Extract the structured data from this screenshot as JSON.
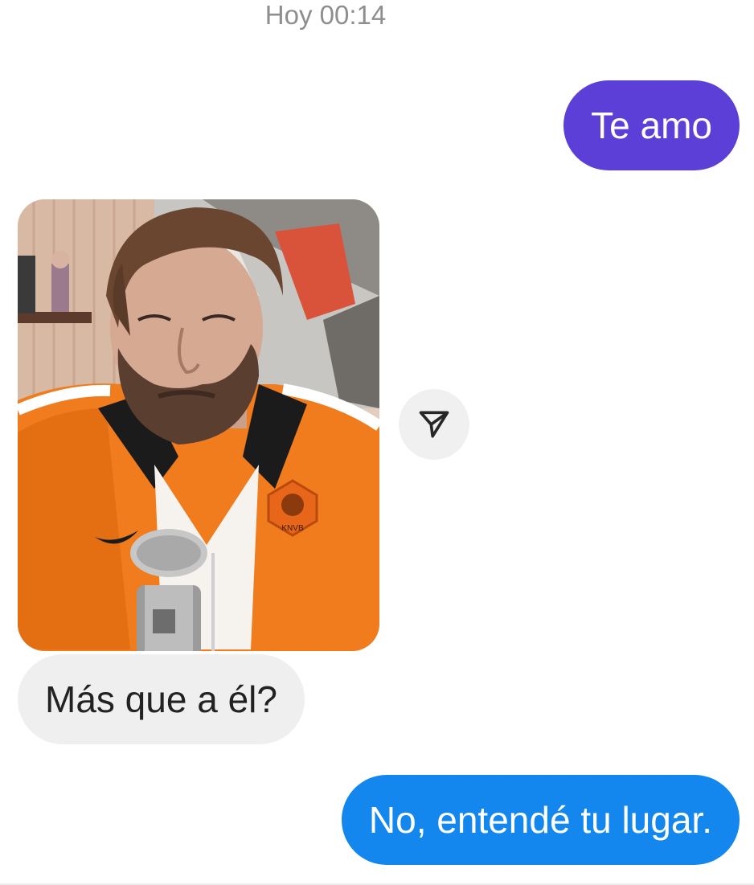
{
  "header": {
    "timestamp": "Hoy 00:14"
  },
  "messages": [
    {
      "direction": "outgoing",
      "text": "Te amo",
      "color": "#5b3fd6"
    },
    {
      "direction": "incoming",
      "type": "image",
      "description": "man-in-orange-jacket"
    },
    {
      "direction": "incoming",
      "text": "Más que a él?",
      "color": "#efefef"
    },
    {
      "direction": "outgoing",
      "text": "No, entendé tu lugar.",
      "color": "#1487ef"
    }
  ],
  "image_logo": {
    "text": "KNVB"
  },
  "icons": {
    "share": "paper-plane-icon"
  }
}
